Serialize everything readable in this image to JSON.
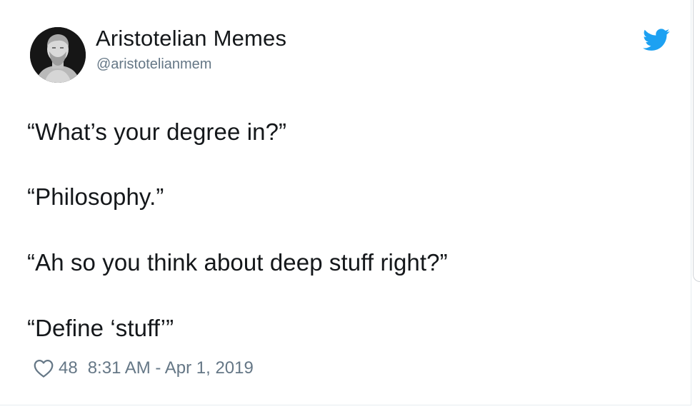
{
  "user": {
    "display_name": "Aristotelian Memes",
    "handle": "@aristotelianmem",
    "avatar_icon": "bust-statue-avatar"
  },
  "brand": {
    "icon": "twitter-bird-icon",
    "color": "#1da1f2"
  },
  "tweet": {
    "lines": [
      "“What’s your degree in?”",
      "“Philosophy.”",
      "“Ah so you think about deep stuff right?”",
      "“Define ‘stuff’”"
    ]
  },
  "footer": {
    "like_icon": "heart-outline-icon",
    "like_count": "48",
    "timestamp": "8:31 AM - Apr 1, 2019"
  }
}
